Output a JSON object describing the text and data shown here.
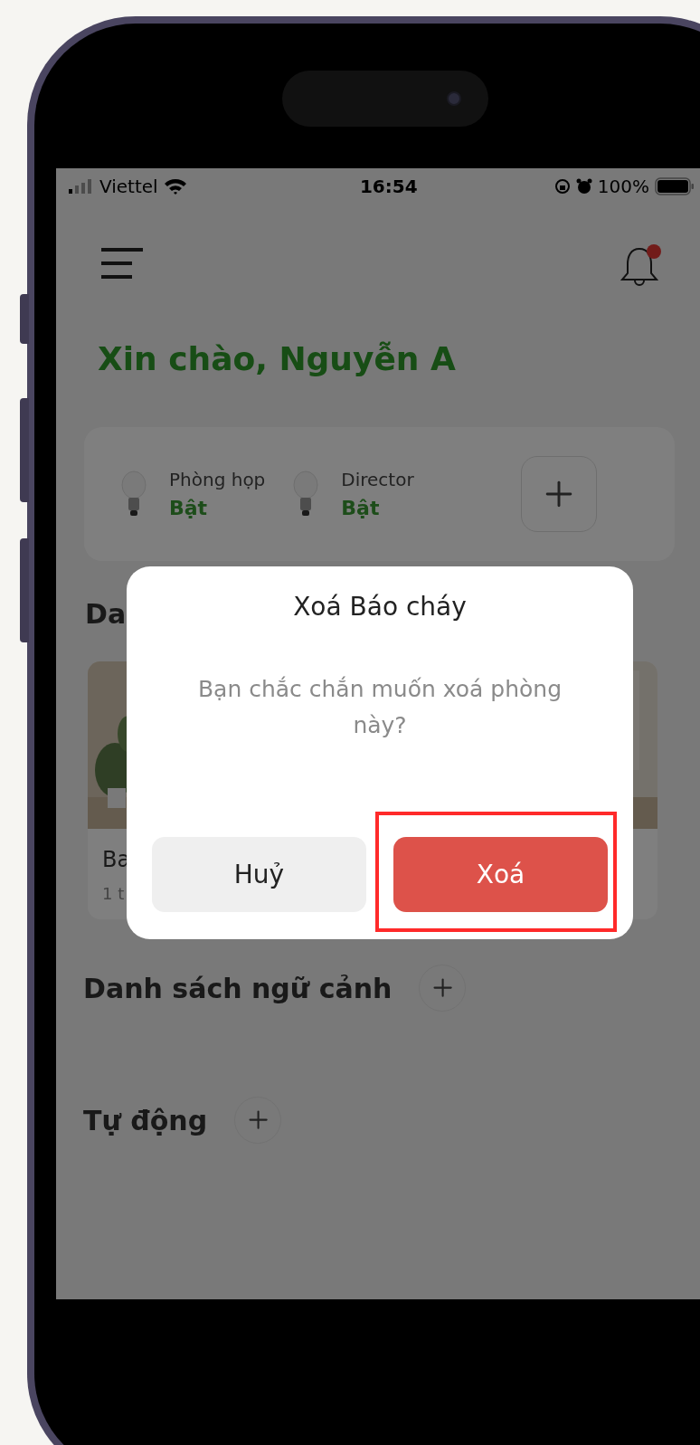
{
  "status_bar": {
    "carrier": "Viettel",
    "time": "16:54",
    "battery": "100%"
  },
  "header": {
    "has_unread": true
  },
  "greeting": "Xin chào, Nguyễn A",
  "devices": [
    {
      "name": "Phòng họp",
      "state": "Bật"
    },
    {
      "name": "Director",
      "state": "Bật"
    }
  ],
  "rooms_section": {
    "title": "Da",
    "rooms": [
      {
        "kind": "picture",
        "name": "Ba",
        "detail": "1 t"
      },
      {
        "kind": "picture"
      }
    ]
  },
  "scenes_section": {
    "title": "Danh sách ngữ cảnh"
  },
  "automation_section": {
    "title": "Tự động"
  },
  "dialog": {
    "title": "Xoá Báo cháy",
    "message": "Bạn chắc chắn muốn xoá phòng này?",
    "buttons": [
      {
        "label": "Huỷ",
        "kind": "secondary",
        "highlighted": false
      },
      {
        "label": "Xoá",
        "kind": "danger",
        "highlighted": true
      }
    ]
  }
}
